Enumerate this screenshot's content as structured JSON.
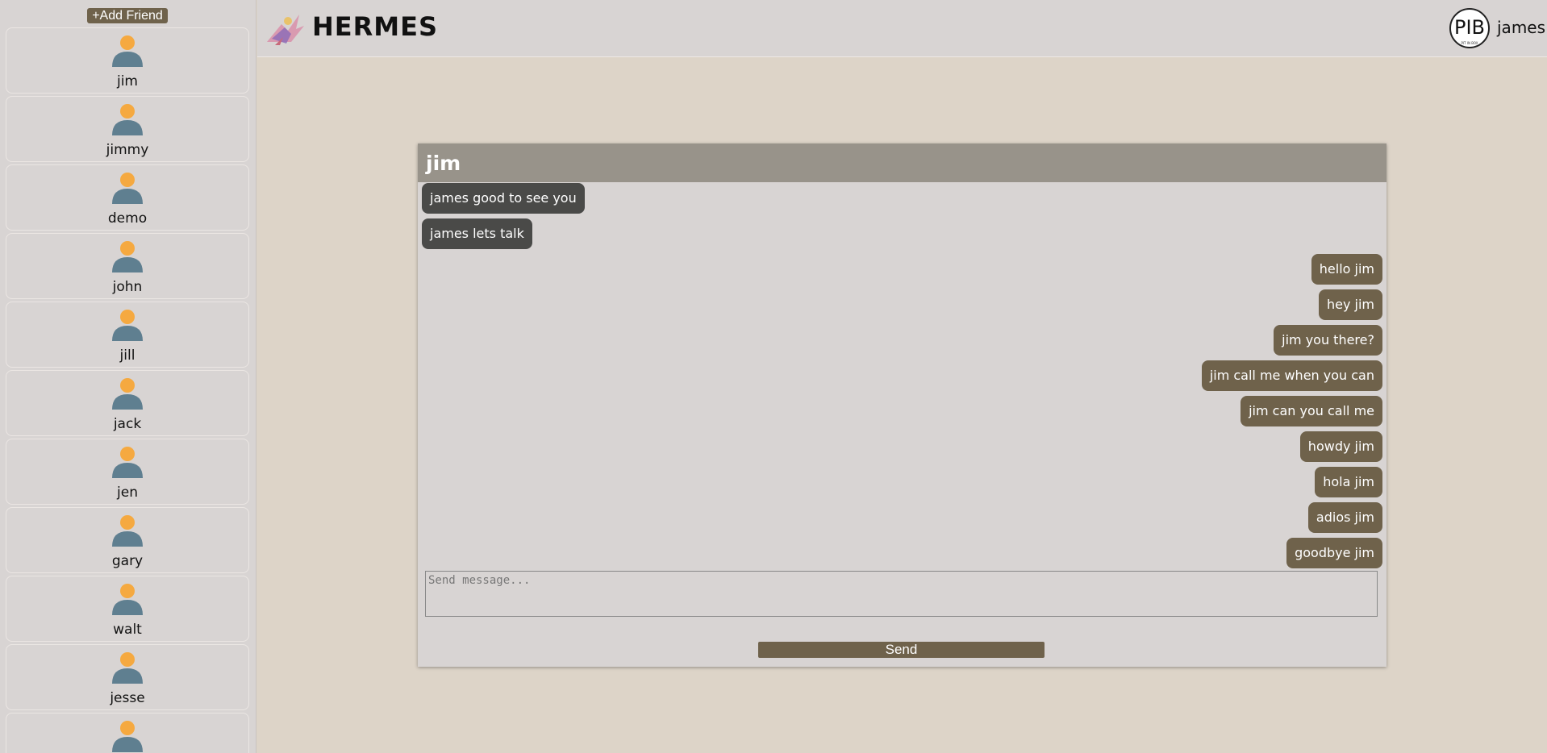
{
  "sidebar": {
    "add_friend_label": "+Add Friend",
    "friends": [
      "jim",
      "jimmy",
      "demo",
      "john",
      "jill",
      "jack",
      "jen",
      "gary",
      "walt",
      "jesse",
      ""
    ]
  },
  "header": {
    "app_name": "HERMES",
    "profile_initials": "PIB",
    "profile_subtext": "PIT IN BOX",
    "username": "james"
  },
  "chat": {
    "title": "jim",
    "messages": [
      {
        "text": "james good to see you",
        "direction": "in"
      },
      {
        "text": "james lets talk",
        "direction": "in"
      },
      {
        "text": "hello jim",
        "direction": "out"
      },
      {
        "text": "hey jim",
        "direction": "out"
      },
      {
        "text": "jim you there?",
        "direction": "out"
      },
      {
        "text": "jim call me when you can",
        "direction": "out"
      },
      {
        "text": "jim can you call me",
        "direction": "out"
      },
      {
        "text": "howdy jim",
        "direction": "out"
      },
      {
        "text": "hola jim",
        "direction": "out"
      },
      {
        "text": "adios jim",
        "direction": "out"
      },
      {
        "text": "goodbye jim",
        "direction": "out"
      }
    ],
    "input_placeholder": "Send message...",
    "send_label": "Send"
  },
  "colors": {
    "accent": "#6f624b",
    "incoming_bubble": "#4a4a48",
    "chat_header": "#98938a",
    "background": "#ddd4c8",
    "panel": "#d8d4d3",
    "avatar_head": "#f5a940",
    "avatar_body": "#5f7f90"
  },
  "icons": {
    "friend_avatar": "user-avatar-icon",
    "logo": "hermes-logo-icon"
  }
}
